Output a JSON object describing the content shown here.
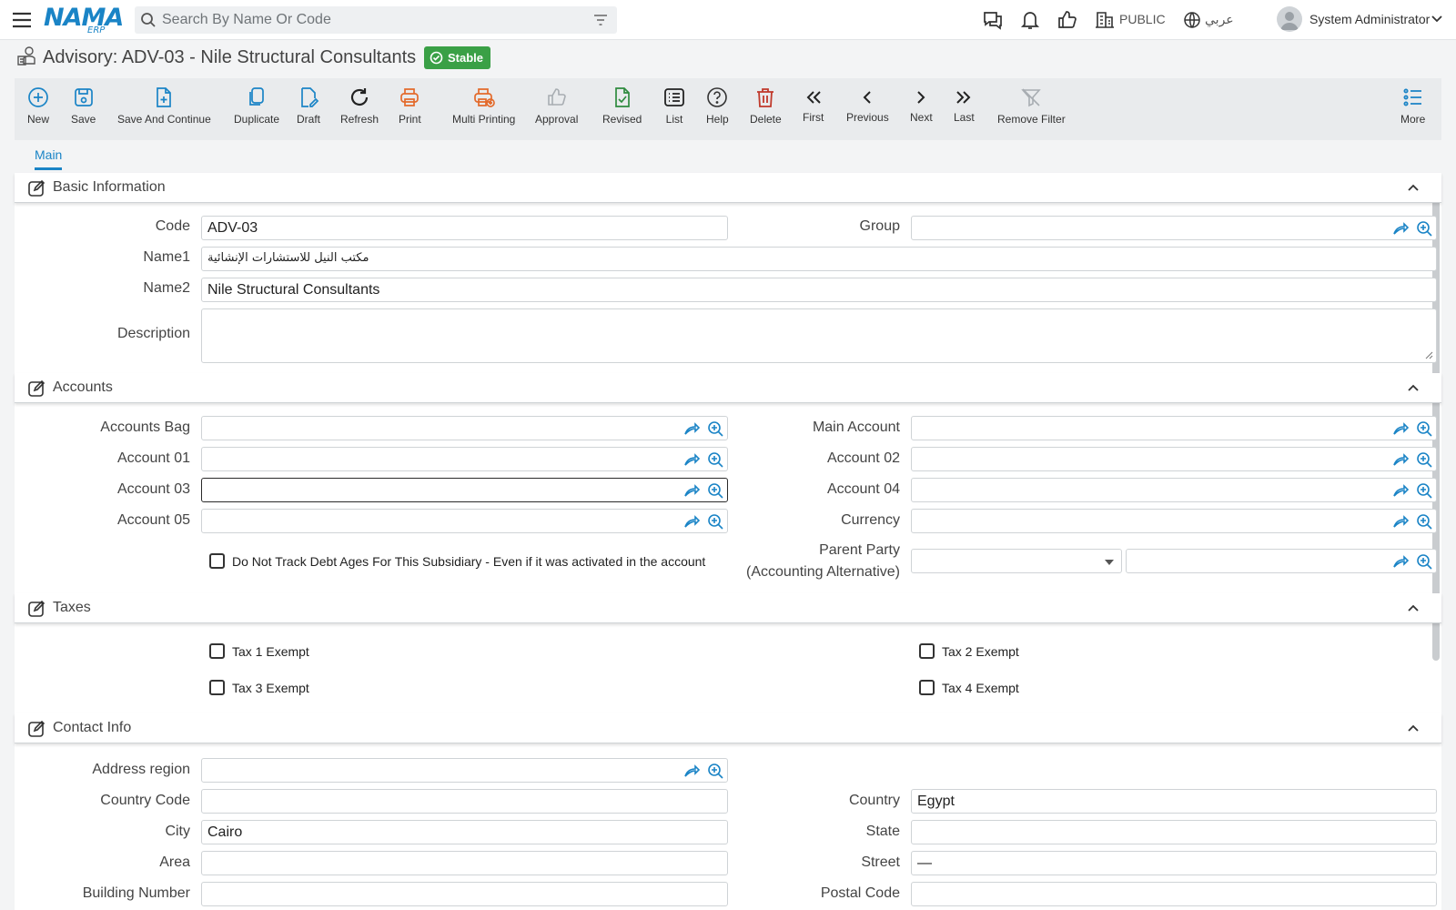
{
  "header": {
    "logo_text": "NAMA",
    "logo_sub": "ERP",
    "search_placeholder": "Search By Name Or Code",
    "branch": "PUBLIC",
    "language": "عربي",
    "user": "System Administrator"
  },
  "page": {
    "title": "Advisory: ADV-03 - Nile Structural Consultants",
    "status": "Stable"
  },
  "toolbar": {
    "new": "New",
    "save": "Save",
    "save_continue": "Save And Continue",
    "duplicate": "Duplicate",
    "draft": "Draft",
    "refresh": "Refresh",
    "print": "Print",
    "multi_printing": "Multi Printing",
    "approval": "Approval",
    "revised": "Revised",
    "list": "List",
    "help": "Help",
    "delete": "Delete",
    "first": "First",
    "previous": "Previous",
    "next": "Next",
    "last": "Last",
    "remove_filter": "Remove Filter",
    "more": "More"
  },
  "tabs": {
    "main": "Main"
  },
  "sections": {
    "basic": "Basic Information",
    "accounts": "Accounts",
    "taxes": "Taxes",
    "contact": "Contact Info"
  },
  "basic": {
    "code_label": "Code",
    "code_value": "ADV-03",
    "group_label": "Group",
    "group_value": "",
    "name1_label": "Name1",
    "name1_value": "مكتب النيل للاستشارات الإنشائية",
    "name2_label": "Name2",
    "name2_value": "Nile Structural Consultants",
    "description_label": "Description",
    "description_value": ""
  },
  "accounts": {
    "accounts_bag": "Accounts Bag",
    "main_account": "Main Account",
    "account01": "Account 01",
    "account02": "Account 02",
    "account03": "Account 03",
    "account04": "Account 04",
    "account05": "Account 05",
    "currency": "Currency",
    "debt_ages": "Do Not Track Debt Ages For This Subsidiary - Even if it was activated in the account",
    "parent_party_line1": "Parent Party",
    "parent_party_line2": "(Accounting Alternative)"
  },
  "taxes": {
    "tax1": "Tax 1 Exempt",
    "tax2": "Tax 2 Exempt",
    "tax3": "Tax 3 Exempt",
    "tax4": "Tax 4 Exempt"
  },
  "contact": {
    "address_region_label": "Address region",
    "country_code_label": "Country Code",
    "country_code_value": "",
    "country_label": "Country",
    "country_value": "Egypt",
    "city_label": "City",
    "city_value": "Cairo",
    "state_label": "State",
    "state_value": "",
    "area_label": "Area",
    "area_value": "",
    "street_label": "Street",
    "street_value": "—",
    "building_label": "Building Number",
    "building_value": "",
    "postal_label": "Postal Code",
    "postal_value": ""
  },
  "colors": {
    "accent": "#1a84c6",
    "status_green": "#3aa046",
    "print_orange": "#e36a2b",
    "delete_red": "#c0392b"
  },
  "icons": [
    "menu-icon",
    "search-icon",
    "filter-icon",
    "chat-icon",
    "bell-icon",
    "thumbs-up-icon",
    "building-icon",
    "globe-icon",
    "user-icon",
    "chevron-down-icon"
  ]
}
